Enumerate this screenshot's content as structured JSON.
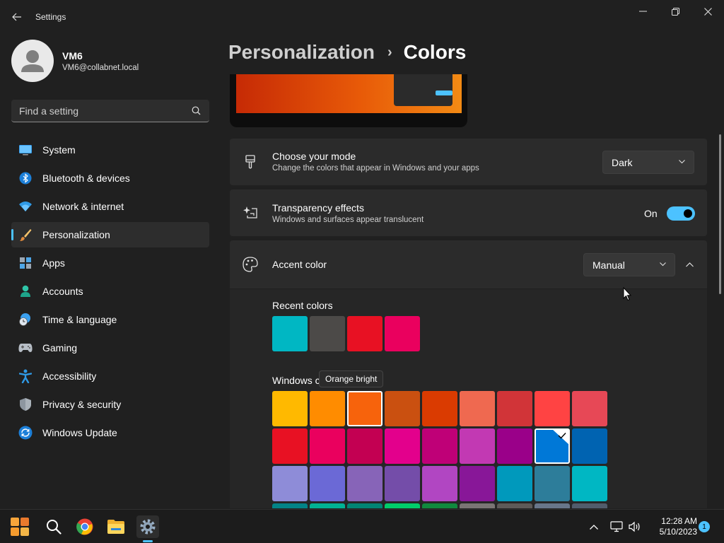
{
  "window": {
    "app_title": "Settings",
    "back_icon": "back-arrow-icon",
    "controls": [
      "minimize-icon",
      "restore-icon",
      "close-icon"
    ]
  },
  "profile": {
    "name": "VM6",
    "email": "VM6@collabnet.local"
  },
  "search": {
    "placeholder": "Find a setting",
    "value": ""
  },
  "sidebar": {
    "items": [
      {
        "label": "System",
        "icon": "system-icon"
      },
      {
        "label": "Bluetooth & devices",
        "icon": "bluetooth-icon"
      },
      {
        "label": "Network & internet",
        "icon": "wifi-icon"
      },
      {
        "label": "Personalization",
        "icon": "brush-icon",
        "selected": true
      },
      {
        "label": "Apps",
        "icon": "apps-icon"
      },
      {
        "label": "Accounts",
        "icon": "accounts-icon"
      },
      {
        "label": "Time & language",
        "icon": "clock-globe-icon"
      },
      {
        "label": "Gaming",
        "icon": "gamepad-icon"
      },
      {
        "label": "Accessibility",
        "icon": "accessibility-icon"
      },
      {
        "label": "Privacy & security",
        "icon": "shield-icon"
      },
      {
        "label": "Windows Update",
        "icon": "update-icon"
      }
    ]
  },
  "breadcrumb": {
    "parent": "Personalization",
    "separator": "›",
    "current": "Colors"
  },
  "mode_card": {
    "title": "Choose your mode",
    "description": "Change the colors that appear in Windows and your apps",
    "value": "Dark"
  },
  "transparency_card": {
    "title": "Transparency effects",
    "description": "Windows and surfaces appear translucent",
    "state_label": "On",
    "enabled": true
  },
  "accent_card": {
    "title": "Accent color",
    "value": "Manual",
    "expanded": true
  },
  "recent_colors": {
    "label": "Recent colors",
    "colors": [
      "#00b7c3",
      "#4c4a48",
      "#e81123",
      "#ea005e"
    ]
  },
  "windows_colors": {
    "label": "Windows colors",
    "label_visible": "Windows c",
    "tooltip": "Orange bright",
    "rows": [
      [
        "#ffb900",
        "#ff8c00",
        "#f7630c",
        "#ca5010",
        "#da3b01",
        "#ef6950",
        "#d13438",
        "#ff4343",
        "#e74856"
      ],
      [
        "#e81123",
        "#ea005e",
        "#c30052",
        "#e3008c",
        "#bf0077",
        "#c239b3",
        "#9a0089",
        "#0078d7",
        "#0063b1"
      ],
      [
        "#8e8cd8",
        "#6b69d6",
        "#8764b8",
        "#744da9",
        "#b146c2",
        "#881798",
        "#0099bc",
        "#2d7d9a",
        "#00b7c3"
      ],
      [
        "#038387",
        "#00b294",
        "#018574",
        "#00cc6a",
        "#10893e",
        "#7a7574",
        "#5d5a58",
        "#68768a",
        "#515c6b"
      ]
    ],
    "hovered": "#f7630c",
    "selected": "#0078d7"
  },
  "taskbar": {
    "apps": [
      "start-icon",
      "search-icon",
      "chrome-icon",
      "file-explorer-icon",
      "settings-icon"
    ],
    "time": "12:28 AM",
    "date": "5/10/2023",
    "notification_count": "1"
  }
}
